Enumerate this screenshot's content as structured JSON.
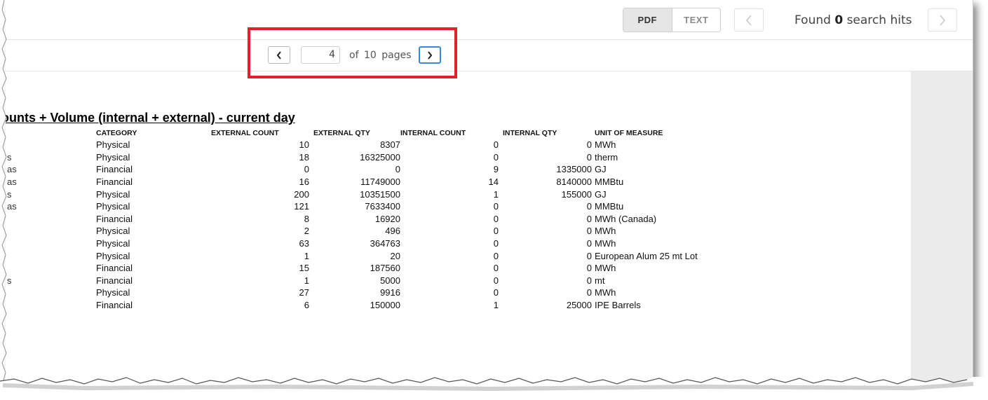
{
  "toolbar": {
    "view_modes": [
      {
        "label": "PDF",
        "active": true
      },
      {
        "label": "TEXT",
        "active": false
      }
    ],
    "search_prev_icon": "chevron-left-icon",
    "search_next_icon": "chevron-right-icon",
    "hits_prefix": "Found",
    "hits_count": "0",
    "hits_suffix": "search hits"
  },
  "pager": {
    "prev_icon": "chevron-left-icon",
    "next_icon": "chevron-right-icon",
    "current_page": "4",
    "of_label": "of",
    "total_pages": "10",
    "pages_label": "pages"
  },
  "highlight_color": "#e0202a",
  "report": {
    "title": "ounts + Volume (internal + external) - current day",
    "columns": [
      "",
      "CATEGORY",
      "EXTERNAL COUNT",
      "EXTERNAL QTY",
      "INTERNAL COUNT",
      "INTERNAL QTY",
      "UNIT OF MEASURE"
    ],
    "rows": [
      [
        "",
        "Physical",
        "10",
        "8307",
        "0",
        "0",
        "MWh"
      ],
      [
        "s",
        "Physical",
        "18",
        "16325000",
        "0",
        "0",
        "therm"
      ],
      [
        "as",
        "Financial",
        "0",
        "0",
        "9",
        "1335000",
        "GJ"
      ],
      [
        "as",
        "Financial",
        "16",
        "11749000",
        "14",
        "8140000",
        "MMBtu"
      ],
      [
        "s",
        "Physical",
        "200",
        "10351500",
        "1",
        "155000",
        "GJ"
      ],
      [
        "as",
        "Physical",
        "121",
        "7633400",
        "0",
        "0",
        "MMBtu"
      ],
      [
        "",
        "Financial",
        "8",
        "16920",
        "0",
        "0",
        "MWh (Canada)"
      ],
      [
        "",
        "Physical",
        "2",
        "496",
        "0",
        "0",
        "MWh"
      ],
      [
        "",
        "Physical",
        "63",
        "364763",
        "0",
        "0",
        "MWh"
      ],
      [
        "",
        "Physical",
        "1",
        "20",
        "0",
        "0",
        "European Alum 25 mt Lot"
      ],
      [
        "",
        "Financial",
        "15",
        "187560",
        "0",
        "0",
        "MWh"
      ],
      [
        "s",
        "Financial",
        "1",
        "5000",
        "0",
        "0",
        "mt"
      ],
      [
        "",
        "Physical",
        "27",
        "9916",
        "0",
        "0",
        "MWh"
      ],
      [
        "",
        "Financial",
        "6",
        "150000",
        "1",
        "25000",
        "IPE Barrels"
      ]
    ]
  }
}
